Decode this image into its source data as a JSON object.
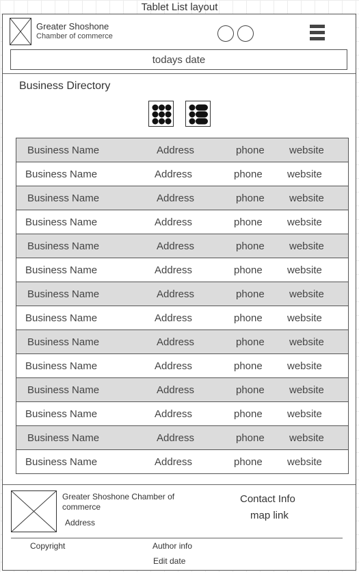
{
  "frame": {
    "title": "Tablet List layout"
  },
  "header": {
    "org_name": "Greater Shoshone",
    "org_sub": "Chamber of commerce",
    "date_text": "todays date"
  },
  "directory": {
    "title": "Business Directory",
    "rows": [
      {
        "name": "Business Name",
        "address": "Address",
        "phone": "phone",
        "website": "website"
      },
      {
        "name": "Business Name",
        "address": "Address",
        "phone": "phone",
        "website": "website"
      },
      {
        "name": "Business Name",
        "address": "Address",
        "phone": "phone",
        "website": "website"
      },
      {
        "name": "Business Name",
        "address": "Address",
        "phone": "phone",
        "website": "website"
      },
      {
        "name": "Business Name",
        "address": "Address",
        "phone": "phone",
        "website": "website"
      },
      {
        "name": "Business Name",
        "address": "Address",
        "phone": "phone",
        "website": "website"
      },
      {
        "name": "Business Name",
        "address": "Address",
        "phone": "phone",
        "website": "website"
      },
      {
        "name": "Business Name",
        "address": "Address",
        "phone": "phone",
        "website": "website"
      },
      {
        "name": "Business Name",
        "address": "Address",
        "phone": "phone",
        "website": "website"
      },
      {
        "name": "Business Name",
        "address": "Address",
        "phone": "phone",
        "website": "website"
      },
      {
        "name": "Business Name",
        "address": "Address",
        "phone": "phone",
        "website": "website"
      },
      {
        "name": "Business Name",
        "address": "Address",
        "phone": "phone",
        "website": "website"
      },
      {
        "name": "Business Name",
        "address": "Address",
        "phone": "phone",
        "website": "website"
      },
      {
        "name": "Business Name",
        "address": "Address",
        "phone": "phone",
        "website": "website"
      }
    ]
  },
  "footer": {
    "org_name": "Greater Shoshone Chamber of commerce",
    "address": "Address",
    "contact": "Contact Info",
    "map_link": "map link",
    "copyright": "Copyright",
    "author": "Author info",
    "edit_date": "Edit date"
  },
  "icons": {
    "logo": "logo-placeholder-icon",
    "footer_logo": "logo-placeholder-icon",
    "circles": [
      "circle-icon",
      "circle-icon"
    ],
    "menu": "hamburger-menu-icon",
    "grid_view": "grid-view-icon",
    "list_view": "list-view-icon"
  },
  "colors": {
    "alt_row": "#dcdcdc",
    "line": "#555555",
    "text": "#333333"
  }
}
